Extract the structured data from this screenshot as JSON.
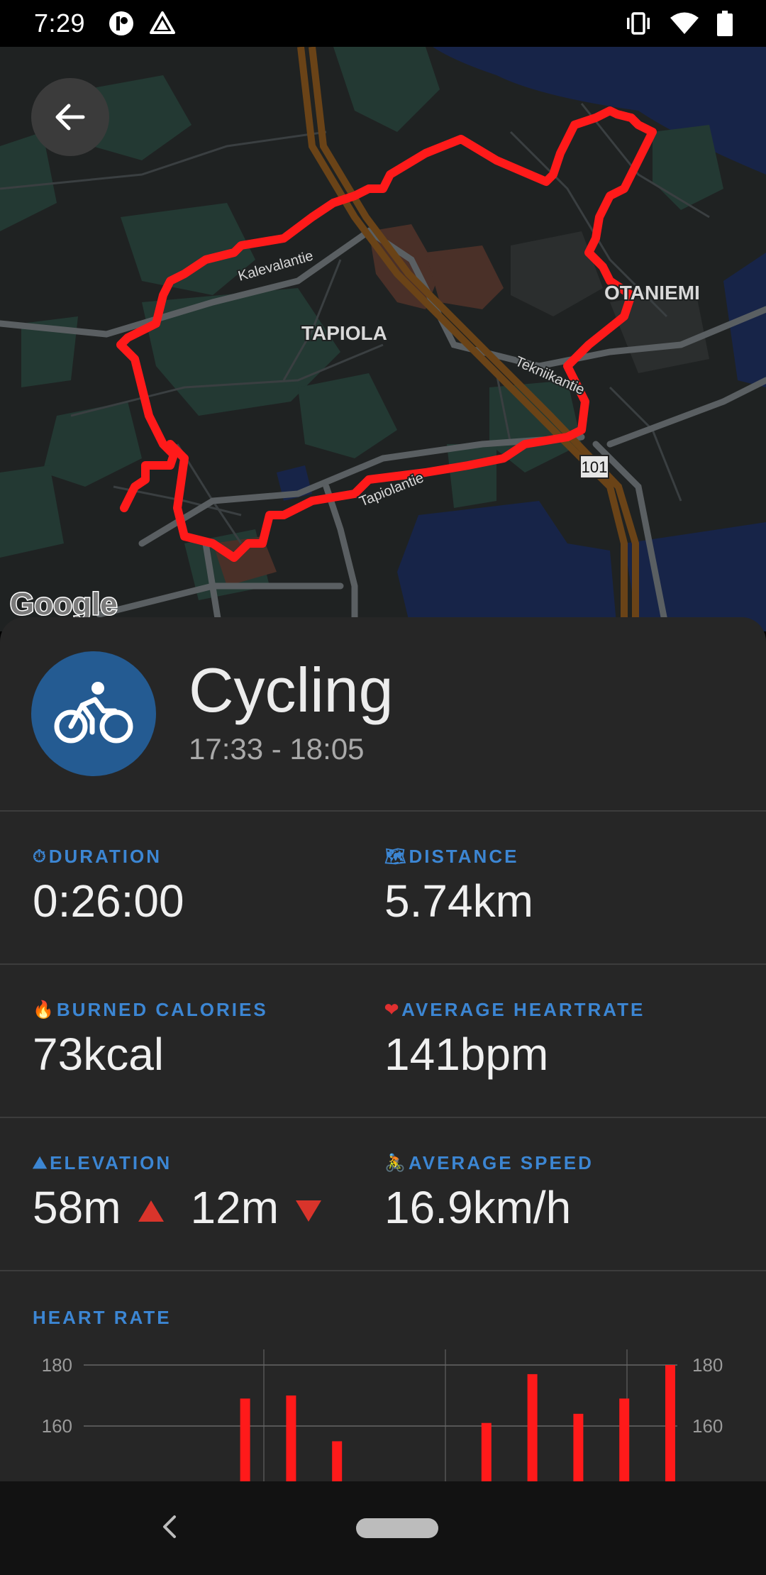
{
  "status_bar": {
    "time": "7:29"
  },
  "map": {
    "labels": {
      "tapiola": "TAPIOLA",
      "otaniemi": "OTANIEMI",
      "kalevalantie": "Kalevalantie",
      "tekniikantie": "Tekniikantie",
      "tapiolantie": "Tapiolantie",
      "road_number": "101",
      "attribution": "Google"
    },
    "route_color": "#ff1a1a"
  },
  "activity": {
    "title": "Cycling",
    "time_range": "17:33 - 18:05",
    "icon": "bicycle-icon"
  },
  "stats": {
    "duration": {
      "emoji": "⏱",
      "label": "DURATION",
      "value": "0:26:00"
    },
    "distance": {
      "emoji": "🗺",
      "label": "DISTANCE",
      "value": "5.74km"
    },
    "calories": {
      "emoji": "🔥",
      "label": "BURNED CALORIES",
      "value": "73kcal"
    },
    "heartrate": {
      "emoji": "❤",
      "label": "AVERAGE HEARTRATE",
      "value": "141bpm"
    },
    "elevation": {
      "emoji": "⛰",
      "label": "ELEVATION",
      "gain": "58m",
      "loss": "12m"
    },
    "speed": {
      "emoji": "🚴",
      "label": "AVERAGE SPEED",
      "value": "16.9km/h"
    }
  },
  "heart_rate_section": {
    "label": "HEART RATE"
  },
  "chart_data": {
    "type": "bar",
    "title": "HEART RATE",
    "y_ticks": [
      "180",
      "160"
    ],
    "y_ticks_right": [
      "180",
      "160"
    ],
    "ylim": [
      148,
      186
    ],
    "bars": [
      {
        "x": 0.32,
        "top": 169
      },
      {
        "x": 0.38,
        "top": 170
      },
      {
        "x": 0.44,
        "top": 155
      },
      {
        "x": 0.635,
        "top": 161
      },
      {
        "x": 0.695,
        "top": 177
      },
      {
        "x": 0.755,
        "top": 164
      },
      {
        "x": 0.815,
        "top": 169
      },
      {
        "x": 0.875,
        "top": 180
      }
    ],
    "bar_color": "#ff1a1a",
    "grid": true
  },
  "colors": {
    "accent": "#3c86d3",
    "activity_icon_bg": "#245b92",
    "sheet_bg": "#262626"
  }
}
